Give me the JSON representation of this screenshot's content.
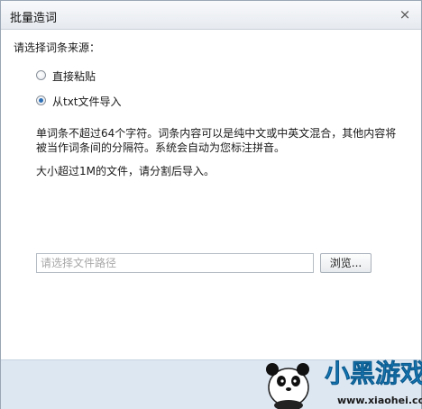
{
  "dialog": {
    "title": "批量造词",
    "close_symbol": "×"
  },
  "source": {
    "label": "请选择词条来源：",
    "options": [
      {
        "label": "直接粘贴",
        "selected": false
      },
      {
        "label": "从txt文件导入",
        "selected": true
      }
    ]
  },
  "notes": {
    "line1": "单词条不超过64个字符。词条内容可以是纯中文或中英文混合，其他内容将",
    "line2": "被当作词条间的分隔符。系统会自动为您标注拼音。",
    "line3": "大小超过1M的文件，请分割后导入。"
  },
  "file": {
    "value": "",
    "placeholder": "请选择文件路径",
    "browse_label": "浏览..."
  },
  "watermark": {
    "brand": "小黑游戏",
    "url": "www.xiaohei.com"
  },
  "colors": {
    "titlebar": "#e9edf2",
    "footer": "#dde7f2",
    "radio_dot": "#2d6fb6",
    "watermark_text": "#1a8fd6"
  }
}
